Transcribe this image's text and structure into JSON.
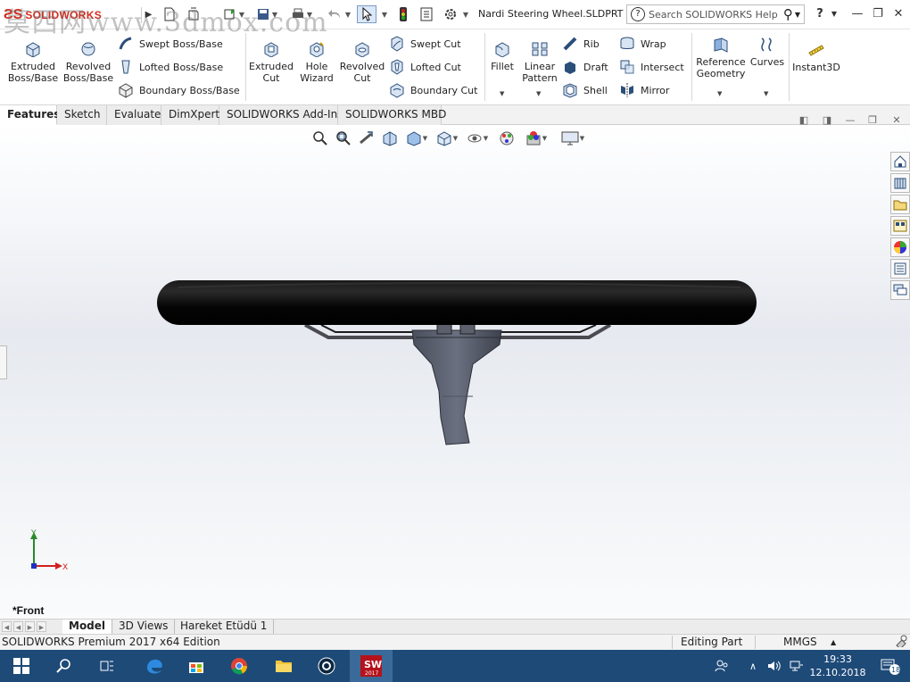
{
  "app": {
    "logo_ds": "ƧS",
    "logo_name": "SOLIDWORKS",
    "document_title": "Nardi Steering Wheel.SLDPRT *",
    "search_placeholder": "Search SOLIDWORKS Help",
    "watermark": "莫西网www.3dmox.com"
  },
  "ribbon": {
    "extruded_boss": "Extruded\nBoss/Base",
    "revolved_boss": "Revolved\nBoss/Base",
    "swept_boss": "Swept Boss/Base",
    "lofted_boss": "Lofted Boss/Base",
    "boundary_boss": "Boundary Boss/Base",
    "extruded_cut": "Extruded\nCut",
    "hole_wizard": "Hole\nWizard",
    "revolved_cut": "Revolved\nCut",
    "swept_cut": "Swept Cut",
    "lofted_cut": "Lofted Cut",
    "boundary_cut": "Boundary Cut",
    "fillet": "Fillet",
    "linear_pattern": "Linear\nPattern",
    "rib": "Rib",
    "draft": "Draft",
    "shell": "Shell",
    "wrap": "Wrap",
    "intersect": "Intersect",
    "mirror": "Mirror",
    "reference_geometry": "Reference\nGeometry",
    "curves": "Curves",
    "instant3d": "Instant3D"
  },
  "tabs": [
    "Features",
    "Sketch",
    "Evaluate",
    "DimXpert",
    "SOLIDWORKS Add-Ins",
    "SOLIDWORKS MBD"
  ],
  "active_tab": "Features",
  "viewport": {
    "view_name": "*Front",
    "axis_x": "X",
    "axis_y": "Y"
  },
  "model_tabs": [
    "Model",
    "3D Views",
    "Hareket Etüdü 1"
  ],
  "active_model_tab": "Model",
  "status": {
    "edition": "SOLIDWORKS Premium 2017 x64 Edition",
    "mode": "Editing Part",
    "units": "MMGS"
  },
  "taskbar": {
    "time": "19:33",
    "date": "12.10.2018",
    "notifications": "18",
    "sw_badge": "2017"
  },
  "colors": {
    "taskbar": "#1e4a78",
    "brand_red": "#d52b1e",
    "axis_x": "#d42020",
    "axis_y": "#2a8a2a",
    "axis_z": "#2030c0"
  }
}
